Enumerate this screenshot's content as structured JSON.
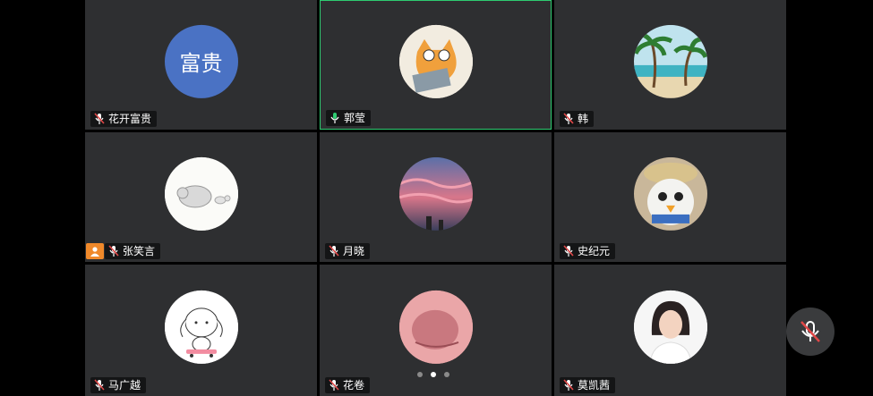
{
  "participants": [
    {
      "name": "花开富贵",
      "avatar_text": "富贵",
      "avatar_color": "#4a72c4",
      "mic": "muted",
      "avatar_kind": "text"
    },
    {
      "name": "郭莹",
      "mic": "active",
      "avatar_kind": "cartoon-cat",
      "active": true
    },
    {
      "name": "韩",
      "mic": "muted",
      "avatar_kind": "beach"
    },
    {
      "name": "张笑言",
      "mic": "muted",
      "avatar_kind": "elephant-sketch",
      "host": true
    },
    {
      "name": "月晓",
      "mic": "muted",
      "avatar_kind": "sunset-sky"
    },
    {
      "name": "史纪元",
      "mic": "muted",
      "avatar_kind": "plush-bird"
    },
    {
      "name": "马广越",
      "mic": "muted",
      "avatar_kind": "bunny-skateboard"
    },
    {
      "name": "花卷",
      "mic": "muted",
      "avatar_kind": "pink-blob"
    },
    {
      "name": "莫凯茜",
      "mic": "muted",
      "avatar_kind": "portrait"
    }
  ],
  "pagination": {
    "pages": 3,
    "current": 2
  },
  "colors": {
    "active_border": "#2ecc71",
    "muted_mic": "#e04848",
    "active_mic": "#2ecc71",
    "host_badge": "#f0892a"
  }
}
